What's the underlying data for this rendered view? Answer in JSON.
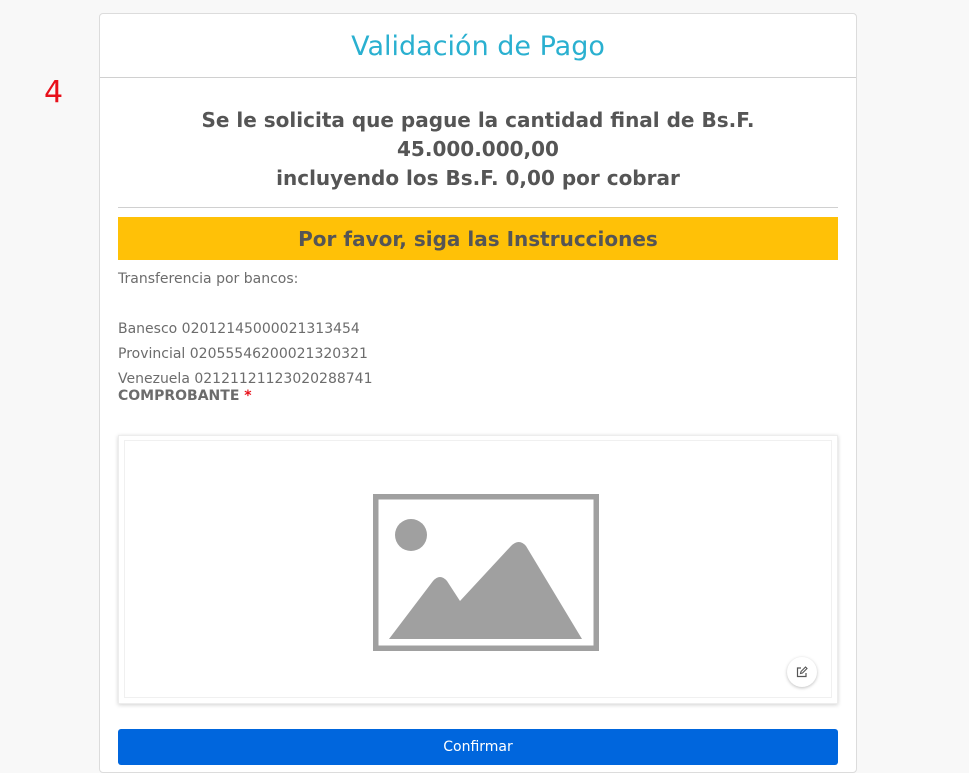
{
  "step": {
    "number": "4"
  },
  "card": {
    "title": "Validación de Pago",
    "amount_line1": "Se le solicita que pague la cantidad final de Bs.F. 45.000.000,00",
    "amount_line2": "incluyendo los Bs.F. 0,00 por cobrar",
    "banner": "Por favor, siga las Instrucciones",
    "transfer_label": "Transferencia por bancos:",
    "banks": [
      "Banesco 02012145000021313454",
      "Provincial 02055546200021320321",
      "Venezuela 02121121123020288741"
    ],
    "receipt_label": "COMPROBANTE",
    "required_mark": "*",
    "image": {
      "icon": "image-placeholder-icon"
    },
    "edit_icon": "edit-icon",
    "confirm_label": "Confirmar"
  },
  "colors": {
    "title": "#2ab0d0",
    "banner": "#ffc107",
    "button": "#0066dd",
    "step": "#e8101a"
  }
}
